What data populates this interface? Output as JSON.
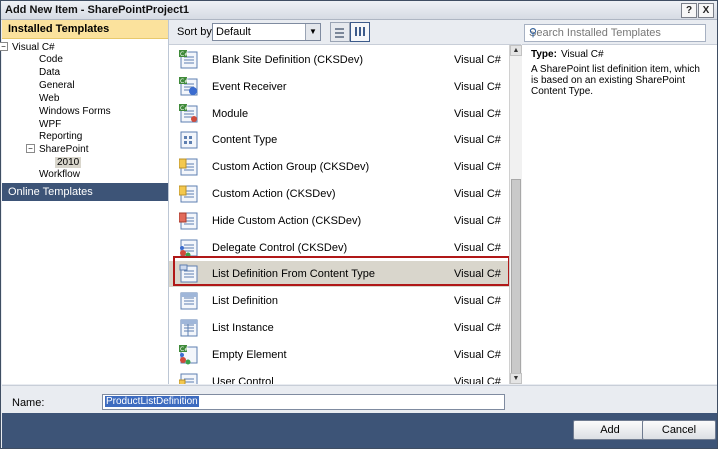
{
  "window": {
    "title": "Add New Item - SharePointProject1",
    "help_button": "?",
    "close_button": "X"
  },
  "left_panel": {
    "header": "Installed Templates",
    "tree": [
      {
        "label": "Visual C#",
        "expander": "−",
        "level": 0
      },
      {
        "label": "Code",
        "level": 1
      },
      {
        "label": "Data",
        "level": 1
      },
      {
        "label": "General",
        "level": 1
      },
      {
        "label": "Web",
        "level": 1
      },
      {
        "label": "Windows Forms",
        "level": 1
      },
      {
        "label": "WPF",
        "level": 1
      },
      {
        "label": "Reporting",
        "level": 1
      },
      {
        "label": "SharePoint",
        "expander": "−",
        "level": 1
      },
      {
        "label": "2010",
        "level": 2,
        "selected": true
      },
      {
        "label": "Workflow",
        "level": 1
      }
    ],
    "online_templates": "Online Templates"
  },
  "toolbar": {
    "sort_label": "Sort by:",
    "sort_value": "Default"
  },
  "search": {
    "placeholder": "Search Installed Templates"
  },
  "templates": [
    {
      "name": "Blank Site Definition (CKSDev)",
      "lang": "Visual C#",
      "icon": "site-definition-icon"
    },
    {
      "name": "Event Receiver",
      "lang": "Visual C#",
      "icon": "event-receiver-icon"
    },
    {
      "name": "Module",
      "lang": "Visual C#",
      "icon": "module-icon"
    },
    {
      "name": "Content Type",
      "lang": "Visual C#",
      "icon": "content-type-icon"
    },
    {
      "name": "Custom Action Group (CKSDev)",
      "lang": "Visual C#",
      "icon": "custom-action-group-icon"
    },
    {
      "name": "Custom Action (CKSDev)",
      "lang": "Visual C#",
      "icon": "custom-action-icon"
    },
    {
      "name": "Hide Custom Action (CKSDev)",
      "lang": "Visual C#",
      "icon": "hide-custom-action-icon"
    },
    {
      "name": "Delegate Control (CKSDev)",
      "lang": "Visual C#",
      "icon": "delegate-control-icon"
    },
    {
      "name": "List Definition From Content Type",
      "lang": "Visual C#",
      "icon": "list-definition-content-type-icon",
      "selected": true
    },
    {
      "name": "List Definition",
      "lang": "Visual C#",
      "icon": "list-definition-icon"
    },
    {
      "name": "List Instance",
      "lang": "Visual C#",
      "icon": "list-instance-icon"
    },
    {
      "name": "Empty Element",
      "lang": "Visual C#",
      "icon": "empty-element-icon"
    },
    {
      "name": "User Control",
      "lang": "Visual C#",
      "icon": "user-control-icon"
    }
  ],
  "details": {
    "type_label": "Type:",
    "type_value": "Visual C#",
    "description": "A SharePoint list definition item, which is based on an existing SharePoint Content Type."
  },
  "name_field": {
    "label": "Name:",
    "value": "ProductListDefinition"
  },
  "buttons": {
    "add": "Add",
    "cancel": "Cancel"
  },
  "colors": {
    "header_yellow": "#fbe29d",
    "dark_bar": "#3d5477",
    "highlight_border": "#b01818",
    "selection": "#d9d6cc"
  }
}
